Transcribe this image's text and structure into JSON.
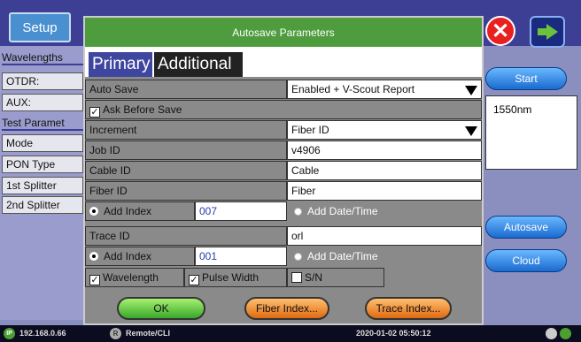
{
  "background": {
    "setup_tab": "Setup",
    "left": {
      "wavelengths_hdr": "Wavelengths",
      "otdr_label": "OTDR:",
      "aux_label": "AUX:",
      "test_params_hdr": "Test Paramet",
      "items": [
        "Mode",
        "PON Type",
        "1st Splitter",
        "2nd Splitter"
      ]
    },
    "right": {
      "start_btn": "Start",
      "trace_label": "1550nm",
      "autosave_btn": "Autosave",
      "cloud_btn": "Cloud"
    }
  },
  "dialog": {
    "title": "Autosave Parameters",
    "tabs": [
      "Primary",
      "Additional"
    ],
    "auto_save": {
      "label": "Auto Save",
      "value": "Enabled + V-Scout Report"
    },
    "ask_before_save": {
      "label": "Ask Before Save",
      "checked": true
    },
    "increment": {
      "label": "Increment",
      "value": "Fiber ID"
    },
    "job_id": {
      "label": "Job ID",
      "value": "v4906"
    },
    "cable_id": {
      "label": "Cable ID",
      "value": "Cable"
    },
    "fiber_id": {
      "label": "Fiber ID",
      "value": "Fiber"
    },
    "fiber_add_index": {
      "label": "Add Index",
      "value": "007",
      "date_label": "Add Date/Time"
    },
    "trace_id": {
      "label": "Trace ID",
      "value": "orl"
    },
    "trace_add_index": {
      "label": "Add Index",
      "value": "001",
      "date_label": "Add Date/Time"
    },
    "wavelength": {
      "label": "Wavelength",
      "checked": true
    },
    "pulse_width": {
      "label": "Pulse Width",
      "checked": true
    },
    "sn": {
      "label": "S/N",
      "checked": false
    },
    "buttons": {
      "ok": "OK",
      "fiber_index": "Fiber Index...",
      "trace_index": "Trace Index..."
    }
  },
  "status_bar": {
    "ip_icon": "IP",
    "ip": "192.168.0.66",
    "remote_icon": "R",
    "remote": "Remote/CLI",
    "datetime": "2020-01-02  05:50:12"
  },
  "colors": {
    "title_bar": "#4e9c3e",
    "primary_tab": "#3f46a0",
    "ok_button": "#3aa82a",
    "index_buttons": "#e06a10"
  }
}
